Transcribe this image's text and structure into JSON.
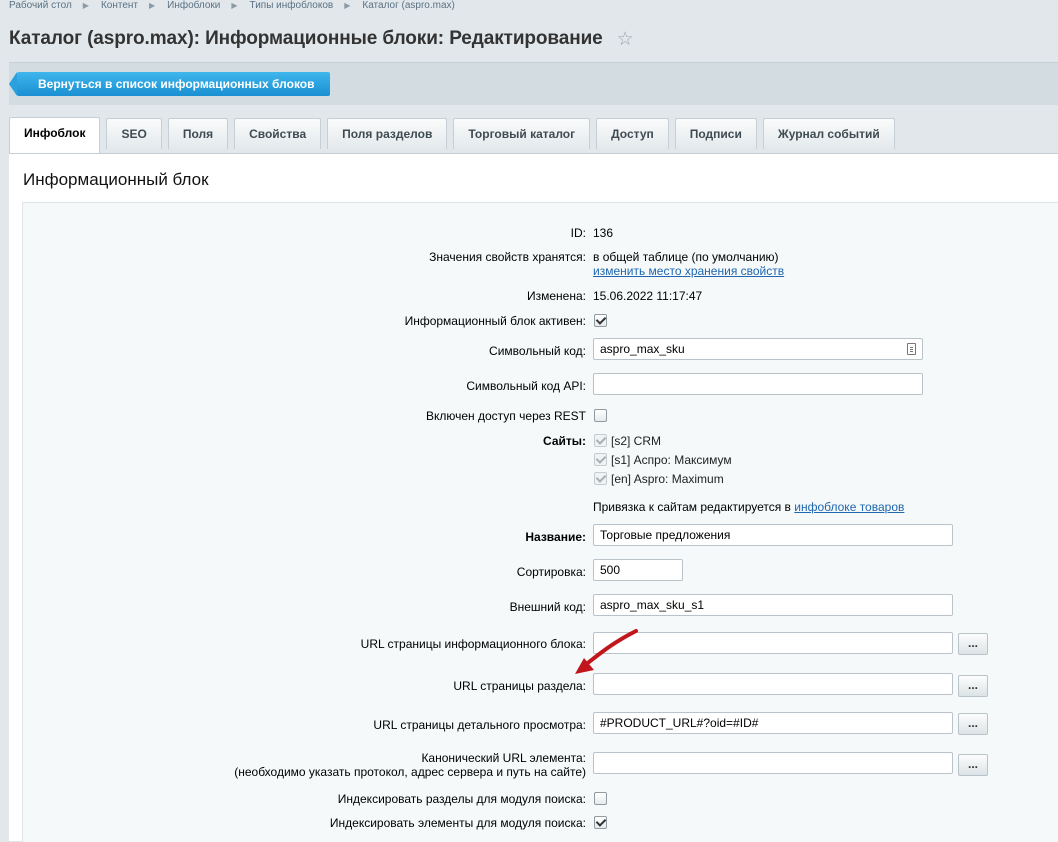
{
  "breadcrumb": [
    "Рабочий стол",
    "Контент",
    "Инфоблоки",
    "Типы инфоблоков",
    "Каталог (aspro.max)"
  ],
  "page_title": "Каталог (aspro.max): Информационные блоки: Редактирование",
  "toolbar": {
    "back_label": "Вернуться в список информационных блоков"
  },
  "tabs": [
    "Инфоблок",
    "SEO",
    "Поля",
    "Свойства",
    "Поля разделов",
    "Торговый каталог",
    "Доступ",
    "Подписи",
    "Журнал событий"
  ],
  "active_tab": "Инфоблок",
  "section_title": "Информационный блок",
  "form": {
    "id_label": "ID:",
    "id_value": "136",
    "storage_label": "Значения свойств хранятся:",
    "storage_value": "в общей таблице (по умолчанию)",
    "storage_link": "изменить место хранения свойств",
    "modified_label": "Изменена:",
    "modified_value": "15.06.2022 11:17:47",
    "active_label": "Информационный блок активен:",
    "active_checked": true,
    "code_label": "Символьный код:",
    "code_value": "aspro_max_sku",
    "api_code_label": "Символьный код API:",
    "api_code_value": "",
    "rest_label": "Включен доступ через REST",
    "rest_checked": false,
    "sites_label": "Сайты:",
    "sites": [
      "[s2] CRM",
      "[s1] Аспро: Максимум",
      "[en] Aspro: Maximum"
    ],
    "sites_note_prefix": "Привязка к сайтам редактируется в ",
    "sites_note_link": "инфоблоке товаров",
    "name_label": "Название:",
    "name_value": "Торговые предложения",
    "sort_label": "Сортировка:",
    "sort_value": "500",
    "external_code_label": "Внешний код:",
    "external_code_value": "aspro_max_sku_s1",
    "list_url_label": "URL страницы информационного блока:",
    "list_url_value": "",
    "section_url_label": "URL страницы раздела:",
    "section_url_value": "",
    "detail_url_label": "URL страницы детального просмотра:",
    "detail_url_value": "#PRODUCT_URL#?oid=#ID#",
    "canonical_label_1": "Канонический URL элемента:",
    "canonical_label_2": "(необходимо указать протокол, адрес сервера и путь на сайте)",
    "canonical_value": "",
    "dots_label": "...",
    "index_sections_label": "Индексировать разделы для модуля поиска:",
    "index_sections_checked": false,
    "index_elements_label": "Индексировать элементы для модуля поиска:",
    "index_elements_checked": true
  },
  "colors": {
    "accent": "#1a8fd2",
    "link": "#2067b0",
    "arrow": "#c0161c"
  },
  "icons": {
    "star": "star-icon",
    "code_field": "document-icon",
    "annotation": "red-arrow-icon"
  }
}
